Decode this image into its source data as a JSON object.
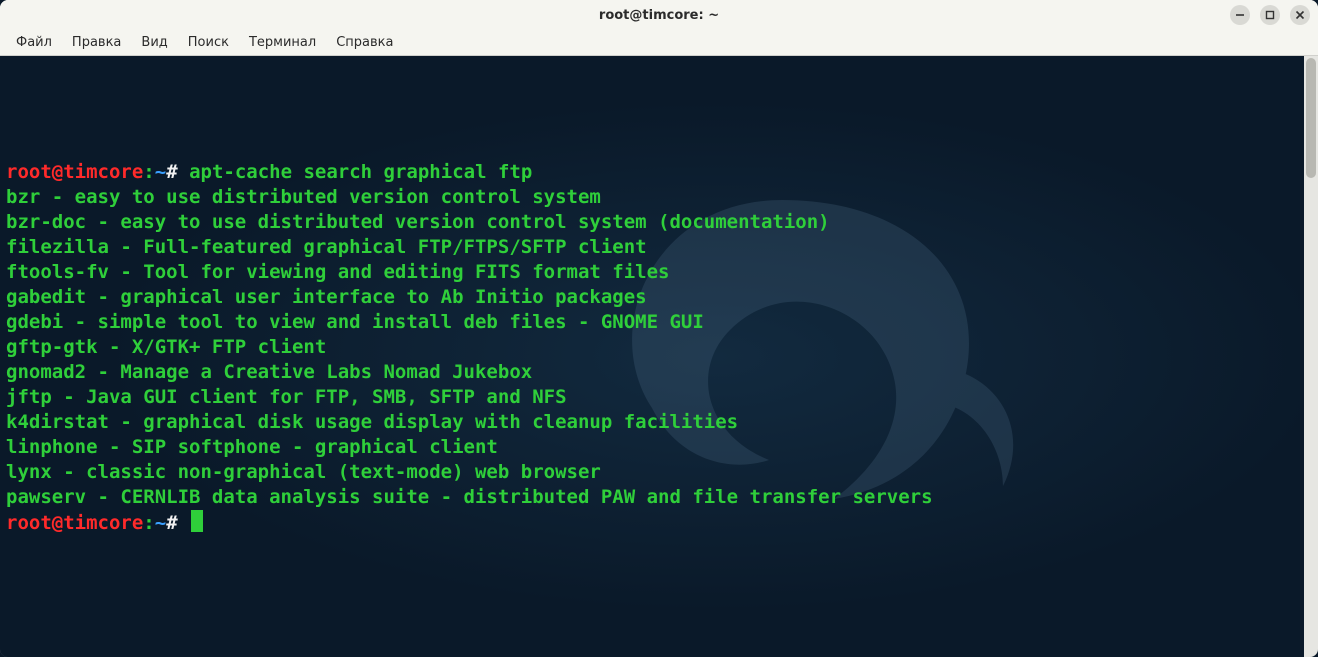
{
  "window": {
    "title": "root@timcore: ~"
  },
  "menubar": {
    "items": [
      {
        "label": "Файл"
      },
      {
        "label": "Правка"
      },
      {
        "label": "Вид"
      },
      {
        "label": "Поиск"
      },
      {
        "label": "Терминал"
      },
      {
        "label": "Справка"
      }
    ]
  },
  "prompt": {
    "user_host": "root@timcore",
    "sep": ":",
    "path": "~",
    "symbol": "#"
  },
  "terminal": {
    "command": "apt-cache search graphical ftp",
    "output": [
      "bzr - easy to use distributed version control system",
      "bzr-doc - easy to use distributed version control system (documentation)",
      "filezilla - Full-featured graphical FTP/FTPS/SFTP client",
      "ftools-fv - Tool for viewing and editing FITS format files",
      "gabedit - graphical user interface to Ab Initio packages",
      "gdebi - simple tool to view and install deb files - GNOME GUI",
      "gftp-gtk - X/GTK+ FTP client",
      "gnomad2 - Manage a Creative Labs Nomad Jukebox",
      "jftp - Java GUI client for FTP, SMB, SFTP and NFS",
      "k4dirstat - graphical disk usage display with cleanup facilities",
      "linphone - SIP softphone - graphical client",
      "lynx - classic non-graphical (text-mode) web browser",
      "pawserv - CERNLIB data analysis suite - distributed PAW and file transfer servers"
    ]
  },
  "colors": {
    "user": "#ff2a2a",
    "path": "#3aa0ff",
    "text": "#2fcf3a",
    "bg": "#0a1929"
  }
}
